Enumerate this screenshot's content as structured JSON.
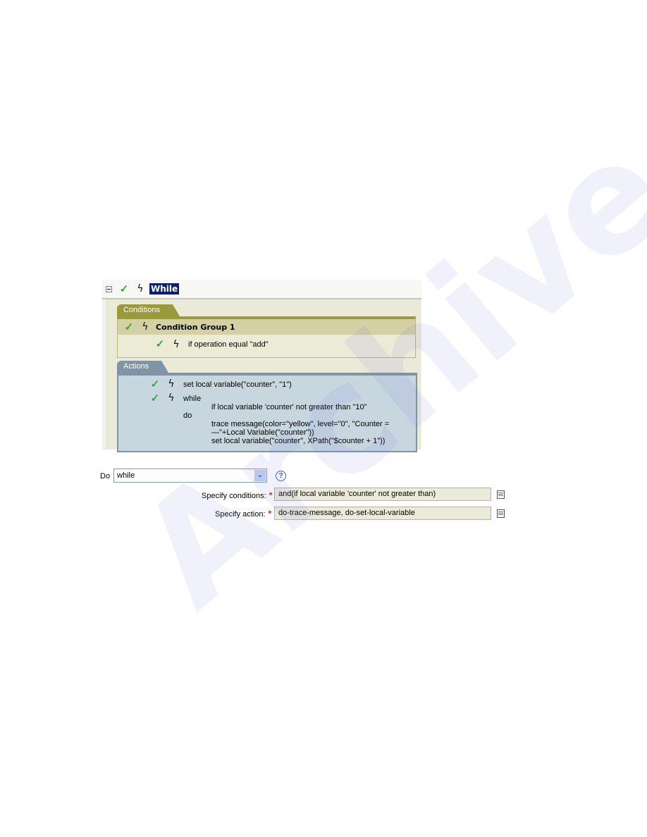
{
  "rule": {
    "title": "While",
    "icons": [
      "collapse-icon",
      "enabled-check-icon",
      "action-bolt-icon"
    ]
  },
  "conditions": {
    "tab_label": "Conditions",
    "group": {
      "label": "Condition Group 1"
    },
    "items": [
      {
        "text": "if operation equal \"add\""
      }
    ]
  },
  "actions": {
    "tab_label": "Actions",
    "items": [
      {
        "text": "set local variable(\"counter\", \"1\")"
      },
      {
        "text": "while",
        "condition": "if local variable 'counter' not greater than \"10\"",
        "do_label": "do",
        "do_lines": [
          "trace message(color=\"yellow\", level=\"0\", \"Counter =",
          "—\"+Local Variable(\"counter\"))",
          "set local variable(\"counter\", XPath(\"$counter + 1\"))"
        ]
      }
    ]
  },
  "form": {
    "do_label": "Do",
    "do_value": "while",
    "help_icon": "?",
    "specify_conditions_label": "Specify conditions:",
    "specify_conditions_value": "and(if local variable 'counter' not greater than)",
    "specify_action_label": "Specify action:",
    "specify_action_value": "do-trace-message, do-set-local-variable",
    "required_marker": "*"
  },
  "colors": {
    "title_highlight": "#0a1f6e",
    "conditions_accent": "#9a9a3c",
    "actions_accent": "#7f95a6",
    "check_green": "#3aa63a",
    "required_red": "#d02020"
  }
}
